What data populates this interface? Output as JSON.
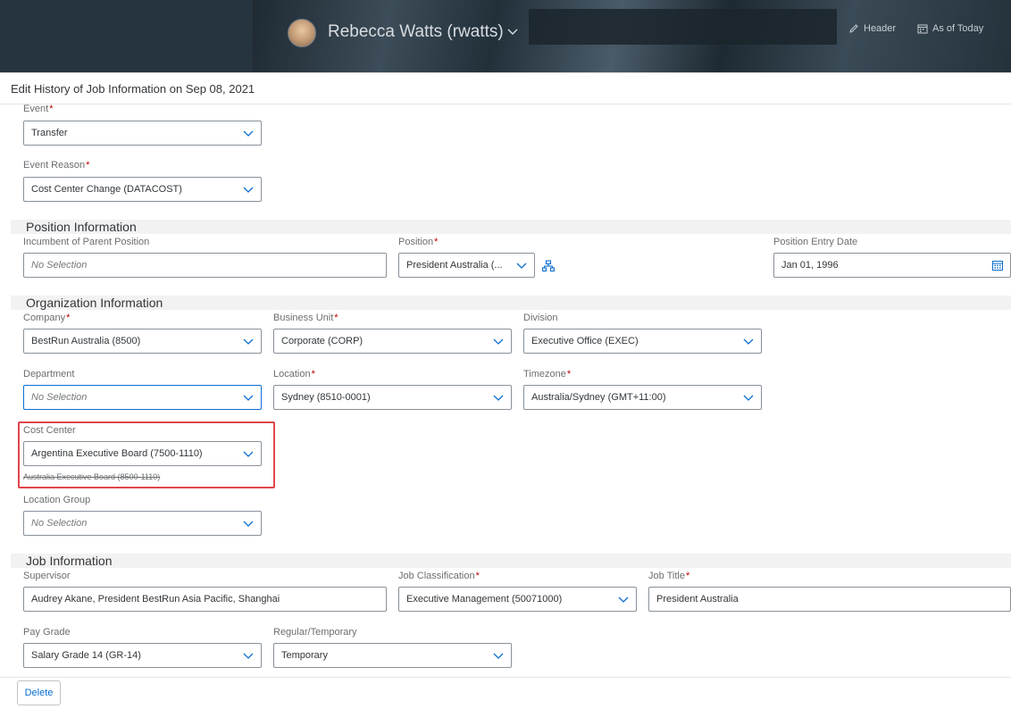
{
  "header": {
    "user_name": "Rebecca Watts (rwatts)",
    "header_button": "Header",
    "as_of_button": "As of Today"
  },
  "dialog": {
    "title": "Edit History of Job Information on Sep 08, 2021"
  },
  "event": {
    "event_label": "Event",
    "event_value": "Transfer",
    "reason_label": "Event Reason",
    "reason_value": "Cost Center Change (DATACOST)"
  },
  "position_section": {
    "title": "Position Information",
    "incumbent_label": "Incumbent of Parent Position",
    "incumbent_placeholder": "No Selection",
    "position_label": "Position",
    "position_value": "President Australia (...",
    "entry_date_label": "Position Entry Date",
    "entry_date_value": "Jan 01, 1996"
  },
  "org_section": {
    "title": "Organization Information",
    "company_label": "Company",
    "company_value": "BestRun Australia (8500)",
    "business_unit_label": "Business Unit",
    "business_unit_value": "Corporate (CORP)",
    "division_label": "Division",
    "division_value": "Executive Office (EXEC)",
    "department_label": "Department",
    "department_placeholder": "No Selection",
    "location_label": "Location",
    "location_value": "Sydney (8510-0001)",
    "timezone_label": "Timezone",
    "timezone_value": "Australia/Sydney (GMT+11:00)",
    "cost_center_label": "Cost Center",
    "cost_center_value": "Argentina Executive Board (7500-1110)",
    "cost_center_old_value": "Australia Executive Board (8500-1110)",
    "location_group_label": "Location Group",
    "location_group_placeholder": "No Selection"
  },
  "job_section": {
    "title": "Job Information",
    "supervisor_label": "Supervisor",
    "supervisor_value": "Audrey Akane, President BestRun Asia Pacific, Shanghai",
    "job_class_label": "Job Classification",
    "job_class_value": "Executive Management (50071000)",
    "job_title_label": "Job Title",
    "job_title_value": "President Australia",
    "pay_grade_label": "Pay Grade",
    "pay_grade_value": "Salary Grade 14 (GR-14)",
    "regular_temp_label": "Regular/Temporary",
    "regular_temp_value": "Temporary"
  },
  "footer": {
    "delete_label": "Delete"
  },
  "colors": {
    "accent": "#0a6ed1",
    "required": "#bb0000",
    "highlight": "#e0454b"
  }
}
